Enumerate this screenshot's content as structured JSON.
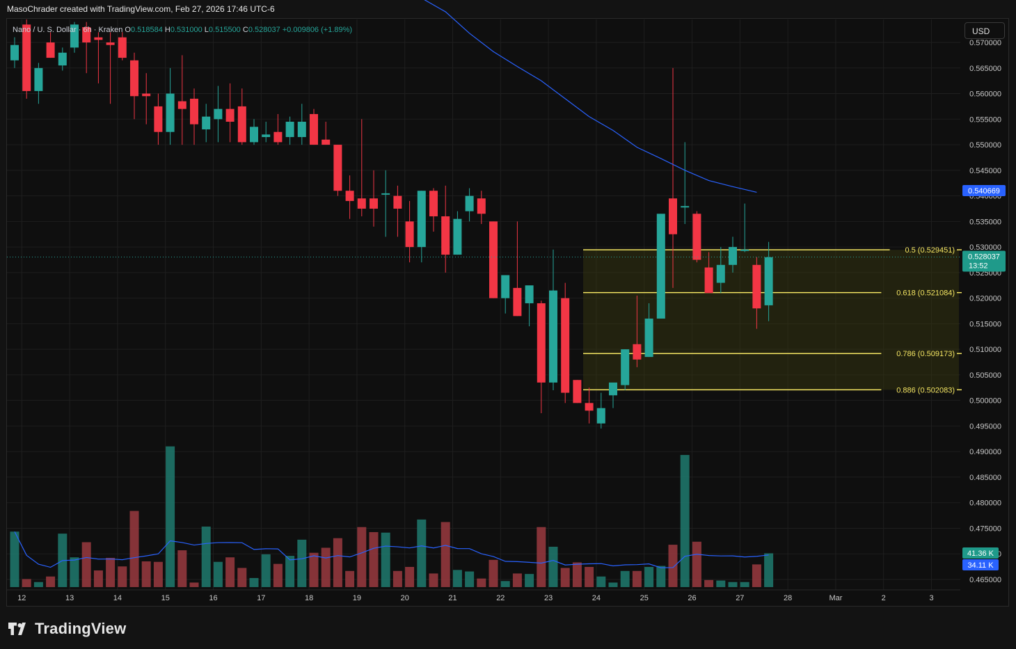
{
  "caption": "MasoChrader created with TradingView.com, Feb 27, 2026 17:46 UTC-6",
  "branding": {
    "name": "TradingView"
  },
  "currency_button": "USD",
  "colors": {
    "up": "#26a69a",
    "down": "#f23645",
    "ma": "#2962ff",
    "fib": "#f5e663",
    "fib_fill": "#3a3a10",
    "background": "#0f0f0f",
    "grid": "#1f1f1f"
  },
  "chart_data": {
    "type": "candlestick",
    "title": "Nano / U. S. Dollar · 6h · Kraken",
    "ohlc_header": {
      "O": "0.518584",
      "H": "0.531000",
      "L": "0.515500",
      "C": "0.528037",
      "change": "+0.009806 (+1.89%)"
    },
    "x_ticks": [
      {
        "label": "12",
        "index": 0.6
      },
      {
        "label": "13",
        "index": 4.6
      },
      {
        "label": "14",
        "index": 8.6
      },
      {
        "label": "15",
        "index": 12.6
      },
      {
        "label": "16",
        "index": 16.6
      },
      {
        "label": "17",
        "index": 20.6
      },
      {
        "label": "18",
        "index": 24.6
      },
      {
        "label": "19",
        "index": 28.6
      },
      {
        "label": "20",
        "index": 32.6
      },
      {
        "label": "21",
        "index": 36.6
      },
      {
        "label": "22",
        "index": 40.6
      },
      {
        "label": "23",
        "index": 44.6
      },
      {
        "label": "24",
        "index": 48.6
      },
      {
        "label": "25",
        "index": 52.6
      },
      {
        "label": "26",
        "index": 56.6
      },
      {
        "label": "27",
        "index": 60.6
      },
      {
        "label": "28",
        "index": 64.6
      },
      {
        "label": "Mar",
        "index": 68.6
      },
      {
        "label": "2",
        "index": 72.6
      },
      {
        "label": "3",
        "index": 76.6
      }
    ],
    "y_range": [
      0.4635,
      0.5715
    ],
    "y_ticks": [
      "0.570000",
      "0.565000",
      "0.560000",
      "0.555000",
      "0.550000",
      "0.545000",
      "0.540000",
      "0.535000",
      "0.530000",
      "0.525000",
      "0.520000",
      "0.515000",
      "0.510000",
      "0.505000",
      "0.500000",
      "0.495000",
      "0.490000",
      "0.485000",
      "0.480000",
      "0.475000",
      "0.470000",
      "0.465000"
    ],
    "candles": [
      {
        "o": 0.5665,
        "h": 0.571,
        "l": 0.565,
        "c": 0.5695
      },
      {
        "o": 0.5735,
        "h": 0.5745,
        "l": 0.559,
        "c": 0.5605
      },
      {
        "o": 0.5605,
        "h": 0.566,
        "l": 0.558,
        "c": 0.565
      },
      {
        "o": 0.57,
        "h": 0.572,
        "l": 0.567,
        "c": 0.567
      },
      {
        "o": 0.5655,
        "h": 0.569,
        "l": 0.5645,
        "c": 0.568
      },
      {
        "o": 0.569,
        "h": 0.574,
        "l": 0.568,
        "c": 0.5735
      },
      {
        "o": 0.573,
        "h": 0.574,
        "l": 0.564,
        "c": 0.57
      },
      {
        "o": 0.571,
        "h": 0.572,
        "l": 0.562,
        "c": 0.5705
      },
      {
        "o": 0.57,
        "h": 0.572,
        "l": 0.558,
        "c": 0.5695
      },
      {
        "o": 0.571,
        "h": 0.572,
        "l": 0.5665,
        "c": 0.567
      },
      {
        "o": 0.5665,
        "h": 0.568,
        "l": 0.555,
        "c": 0.5595
      },
      {
        "o": 0.56,
        "h": 0.564,
        "l": 0.554,
        "c": 0.5595
      },
      {
        "o": 0.5575,
        "h": 0.56,
        "l": 0.55,
        "c": 0.5525
      },
      {
        "o": 0.5525,
        "h": 0.565,
        "l": 0.55,
        "c": 0.56
      },
      {
        "o": 0.5585,
        "h": 0.5675,
        "l": 0.55,
        "c": 0.557
      },
      {
        "o": 0.559,
        "h": 0.561,
        "l": 0.55,
        "c": 0.554
      },
      {
        "o": 0.553,
        "h": 0.558,
        "l": 0.5505,
        "c": 0.5555
      },
      {
        "o": 0.555,
        "h": 0.5615,
        "l": 0.5505,
        "c": 0.557
      },
      {
        "o": 0.557,
        "h": 0.562,
        "l": 0.5505,
        "c": 0.5545
      },
      {
        "o": 0.5575,
        "h": 0.561,
        "l": 0.55,
        "c": 0.5505
      },
      {
        "o": 0.5505,
        "h": 0.555,
        "l": 0.55,
        "c": 0.5535
      },
      {
        "o": 0.5515,
        "h": 0.5545,
        "l": 0.5505,
        "c": 0.552
      },
      {
        "o": 0.5525,
        "h": 0.556,
        "l": 0.55,
        "c": 0.5505
      },
      {
        "o": 0.5515,
        "h": 0.5555,
        "l": 0.55,
        "c": 0.5545
      },
      {
        "o": 0.5515,
        "h": 0.558,
        "l": 0.55,
        "c": 0.5545
      },
      {
        "o": 0.556,
        "h": 0.557,
        "l": 0.55,
        "c": 0.55
      },
      {
        "o": 0.551,
        "h": 0.5545,
        "l": 0.55,
        "c": 0.55
      },
      {
        "o": 0.55,
        "h": 0.55,
        "l": 0.54,
        "c": 0.541
      },
      {
        "o": 0.541,
        "h": 0.544,
        "l": 0.5355,
        "c": 0.539
      },
      {
        "o": 0.5395,
        "h": 0.555,
        "l": 0.536,
        "c": 0.5375
      },
      {
        "o": 0.5395,
        "h": 0.545,
        "l": 0.534,
        "c": 0.5375
      },
      {
        "o": 0.5405,
        "h": 0.545,
        "l": 0.532,
        "c": 0.5405
      },
      {
        "o": 0.54,
        "h": 0.542,
        "l": 0.532,
        "c": 0.5375
      },
      {
        "o": 0.535,
        "h": 0.539,
        "l": 0.527,
        "c": 0.53
      },
      {
        "o": 0.53,
        "h": 0.541,
        "l": 0.527,
        "c": 0.541
      },
      {
        "o": 0.541,
        "h": 0.5415,
        "l": 0.533,
        "c": 0.536
      },
      {
        "o": 0.536,
        "h": 0.542,
        "l": 0.525,
        "c": 0.5285
      },
      {
        "o": 0.5285,
        "h": 0.537,
        "l": 0.5285,
        "c": 0.5355
      },
      {
        "o": 0.537,
        "h": 0.5415,
        "l": 0.535,
        "c": 0.54
      },
      {
        "o": 0.5395,
        "h": 0.541,
        "l": 0.5345,
        "c": 0.5365
      },
      {
        "o": 0.535,
        "h": 0.535,
        "l": 0.52,
        "c": 0.52
      },
      {
        "o": 0.52,
        "h": 0.5245,
        "l": 0.517,
        "c": 0.5245
      },
      {
        "o": 0.522,
        "h": 0.535,
        "l": 0.5165,
        "c": 0.5165
      },
      {
        "o": 0.519,
        "h": 0.522,
        "l": 0.5145,
        "c": 0.5225
      },
      {
        "o": 0.519,
        "h": 0.5195,
        "l": 0.4975,
        "c": 0.5035
      },
      {
        "o": 0.5035,
        "h": 0.5295,
        "l": 0.502,
        "c": 0.5215
      },
      {
        "o": 0.52,
        "h": 0.523,
        "l": 0.4995,
        "c": 0.5015
      },
      {
        "o": 0.504,
        "h": 0.504,
        "l": 0.4995,
        "c": 0.4995
      },
      {
        "o": 0.4995,
        "h": 0.5025,
        "l": 0.4955,
        "c": 0.498
      },
      {
        "o": 0.4955,
        "h": 0.5015,
        "l": 0.4945,
        "c": 0.4985
      },
      {
        "o": 0.501,
        "h": 0.503,
        "l": 0.4985,
        "c": 0.5035
      },
      {
        "o": 0.503,
        "h": 0.51,
        "l": 0.502,
        "c": 0.51
      },
      {
        "o": 0.511,
        "h": 0.5205,
        "l": 0.5065,
        "c": 0.508
      },
      {
        "o": 0.5085,
        "h": 0.519,
        "l": 0.5085,
        "c": 0.516
      },
      {
        "o": 0.516,
        "h": 0.5365,
        "l": 0.516,
        "c": 0.5365
      },
      {
        "o": 0.5395,
        "h": 0.565,
        "l": 0.522,
        "c": 0.5325
      },
      {
        "o": 0.538,
        "h": 0.5505,
        "l": 0.5345,
        "c": 0.538
      },
      {
        "o": 0.5365,
        "h": 0.537,
        "l": 0.527,
        "c": 0.5275
      },
      {
        "o": 0.526,
        "h": 0.529,
        "l": 0.521,
        "c": 0.521
      },
      {
        "o": 0.523,
        "h": 0.53,
        "l": 0.521,
        "c": 0.5265
      },
      {
        "o": 0.5265,
        "h": 0.532,
        "l": 0.525,
        "c": 0.53
      },
      {
        "o": 0.5295,
        "h": 0.5385,
        "l": 0.529,
        "c": 0.5295
      },
      {
        "o": 0.5265,
        "h": 0.528,
        "l": 0.514,
        "c": 0.518
      },
      {
        "o": 0.5186,
        "h": 0.531,
        "l": 0.5155,
        "c": 0.528
      }
    ],
    "volume": {
      "series_name": "Volume",
      "values": [
        11.0,
        1.6,
        1.0,
        2.1,
        10.6,
        5.9,
        8.9,
        3.3,
        5.8,
        4.1,
        15.1,
        5.1,
        5.0,
        27.9,
        7.3,
        0.9,
        12.0,
        5.0,
        5.9,
        3.8,
        1.8,
        6.5,
        4.6,
        6.2,
        9.4,
        6.8,
        7.8,
        9.7,
        3.2,
        11.9,
        10.9,
        10.8,
        3.2,
        4.0,
        13.4,
        2.7,
        12.9,
        3.4,
        3.1,
        1.7,
        5.4,
        1.2,
        2.7,
        2.6,
        11.9,
        8.0,
        3.8,
        4.9,
        4.0,
        2.1,
        0.9,
        3.2,
        3.2,
        4.0,
        4.2,
        8.4,
        26.2,
        9.0,
        1.4,
        1.3,
        1.0,
        1.0,
        4.5,
        6.7
      ],
      "ma_label": "34.11 K",
      "last_label": "41.36 K"
    },
    "moving_average": [
      {
        "index": 33.0,
        "value": 0.58
      },
      {
        "index": 36.0,
        "value": 0.576
      },
      {
        "index": 38.0,
        "value": 0.5718
      },
      {
        "index": 40.0,
        "value": 0.5682
      },
      {
        "index": 42.0,
        "value": 0.5653
      },
      {
        "index": 44.0,
        "value": 0.5625
      },
      {
        "index": 46.0,
        "value": 0.559
      },
      {
        "index": 48.0,
        "value": 0.5555
      },
      {
        "index": 50.0,
        "value": 0.5528
      },
      {
        "index": 52.0,
        "value": 0.5495
      },
      {
        "index": 54.0,
        "value": 0.5473
      },
      {
        "index": 56.0,
        "value": 0.545
      },
      {
        "index": 58.0,
        "value": 0.543
      },
      {
        "index": 60.0,
        "value": 0.5418
      },
      {
        "index": 62.0,
        "value": 0.5407
      }
    ],
    "fib_levels": [
      {
        "label": "0.5 (0.529451)",
        "value": 0.529451
      },
      {
        "label": "0.618 (0.521084)",
        "value": 0.521084
      },
      {
        "label": "0.786 (0.509173)",
        "value": 0.509173
      },
      {
        "label": "0.886 (0.502083)",
        "value": 0.502083
      }
    ],
    "fib_start_index": 47.5,
    "price_labels": {
      "ma_value": "0.540669",
      "last_price": "0.528037",
      "countdown": "13:52"
    }
  }
}
